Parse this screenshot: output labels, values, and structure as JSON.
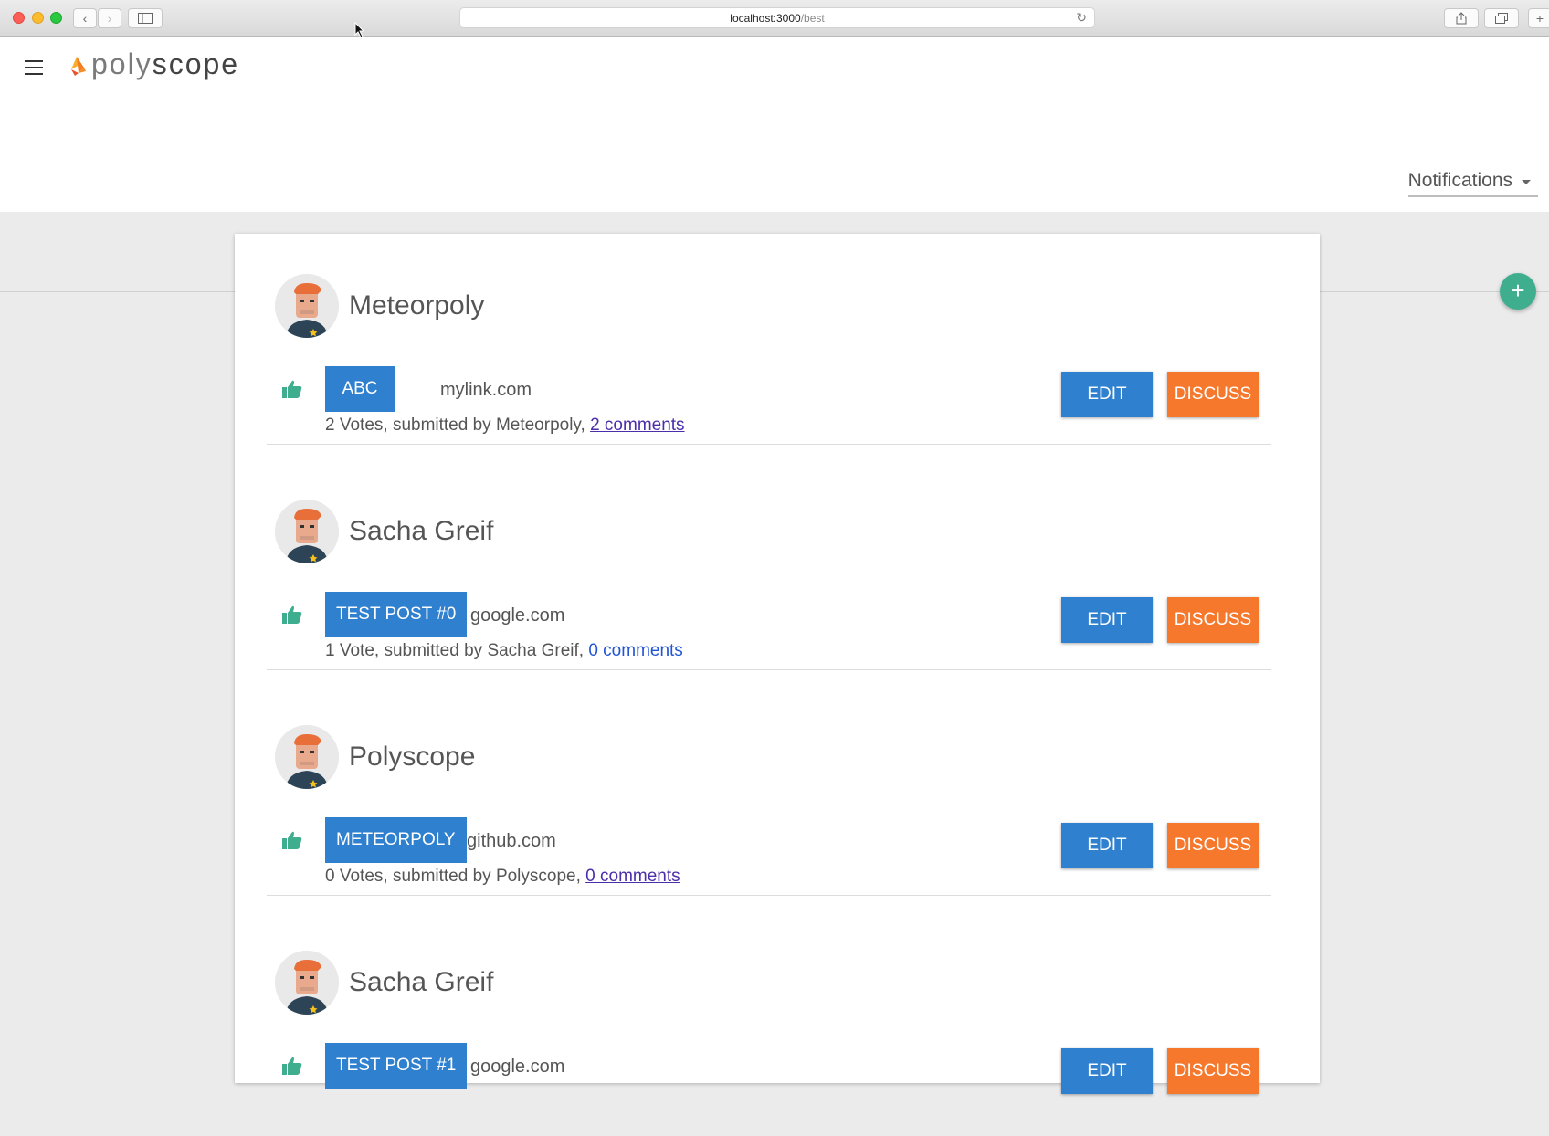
{
  "browser": {
    "url_host": "localhost:3000",
    "url_path": "/best"
  },
  "header": {
    "logo_text_a": "poly",
    "logo_text_b": "scope",
    "notifications_label": "Notifications",
    "fab_label": "+"
  },
  "posts": [
    {
      "author": "Meteorpoly",
      "category": "ABC",
      "domain": "mylink.com",
      "meta_text": "2 Votes, submitted by Meteorpoly,",
      "comments": "2 comments",
      "edit": "EDIT",
      "discuss": "DISCUSS"
    },
    {
      "author": "Sacha Greif",
      "category": "TEST POST #0",
      "domain": "google.com",
      "meta_text": "1 Vote, submitted by Sacha Greif,",
      "comments": "0 comments",
      "edit": "EDIT",
      "discuss": "DISCUSS"
    },
    {
      "author": "Polyscope",
      "category": "METEORPOLY",
      "domain": "github.com",
      "meta_text": "0 Votes, submitted by Polyscope,",
      "comments": "0 comments",
      "edit": "EDIT",
      "discuss": "DISCUSS"
    },
    {
      "author": "Sacha Greif",
      "category": "TEST POST #1",
      "domain": "google.com",
      "meta_text": "",
      "comments": "",
      "edit": "EDIT",
      "discuss": "DISCUSS"
    }
  ],
  "colors": {
    "primary": "#2f80cf",
    "accent": "#f5782d",
    "fab": "#3fae8f",
    "vote": "#3fae8f"
  }
}
